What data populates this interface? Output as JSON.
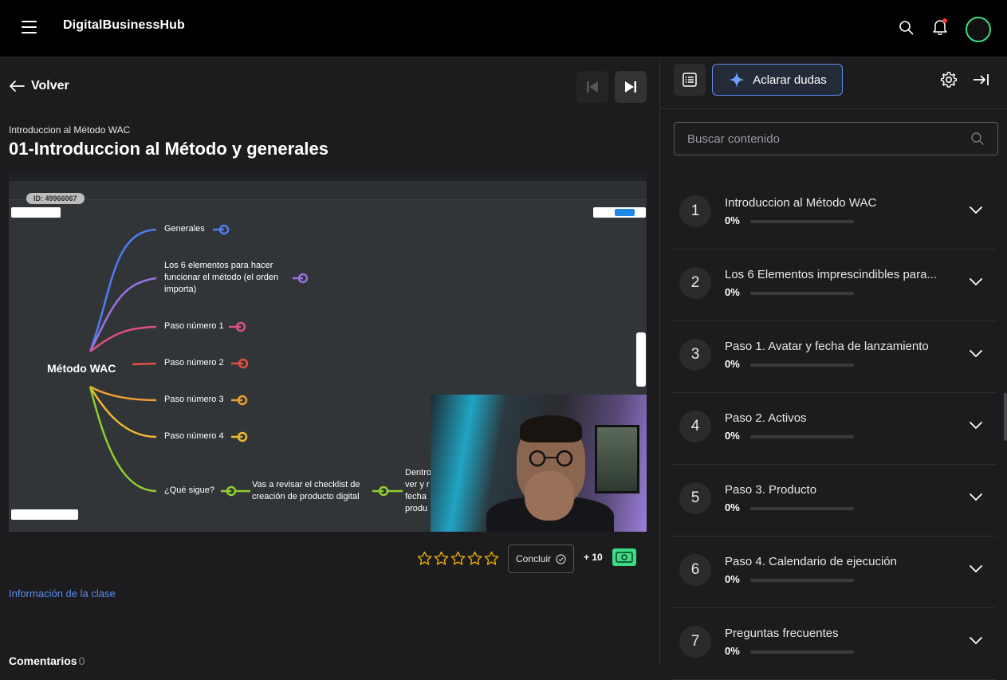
{
  "header": {
    "brand": "DigitalBusinessHub"
  },
  "lesson": {
    "back_label": "Volver",
    "breadcrumb": "Introduccion al Método WAC",
    "title": "01-Introduccion al Método y generales"
  },
  "video": {
    "id_label": "ID: 49966067",
    "mindmap": {
      "root": "Método WAC",
      "nodes": [
        {
          "label": "Generales",
          "color": "#4f7df0"
        },
        {
          "label": "Los 6 elementos para hacer funcionar el método (el orden importa)",
          "color": "#9b72e0"
        },
        {
          "label": "Paso número 1",
          "color": "#e0507e"
        },
        {
          "label": "Paso número 2",
          "color": "#e0503c"
        },
        {
          "label": "Paso número 3",
          "color": "#f0a030"
        },
        {
          "label": "Paso número 4",
          "color": "#f0b830"
        },
        {
          "label": "¿Qué sigue?",
          "color": "#8fcf30"
        }
      ],
      "child_node": "Vas a revisar el checklist de creación de producto digital",
      "grandchild_node": "Dentro ver y r fecha produ"
    }
  },
  "actions": {
    "rating_stars": 5,
    "rating_value": 0,
    "conclude_label": "Concluir",
    "points_label": "+ 10",
    "info_link": "Información de la clase",
    "comments_label": "Comentarios",
    "comments_count": "0"
  },
  "sidebar": {
    "doubts_label": "Aclarar dudas",
    "search_placeholder": "Buscar contenido",
    "accent": "#5b8def",
    "modules": [
      {
        "num": "1",
        "title": "Introduccion al Método WAC",
        "progress": "0%"
      },
      {
        "num": "2",
        "title": "Los 6 Elementos imprescindibles para...",
        "progress": "0%"
      },
      {
        "num": "3",
        "title": "Paso 1. Avatar y fecha de lanzamiento",
        "progress": "0%"
      },
      {
        "num": "4",
        "title": "Paso 2. Activos",
        "progress": "0%"
      },
      {
        "num": "5",
        "title": "Paso 3. Producto",
        "progress": "0%"
      },
      {
        "num": "6",
        "title": "Paso 4. Calendario de ejecución",
        "progress": "0%"
      },
      {
        "num": "7",
        "title": "Preguntas frecuentes",
        "progress": "0%"
      }
    ]
  }
}
